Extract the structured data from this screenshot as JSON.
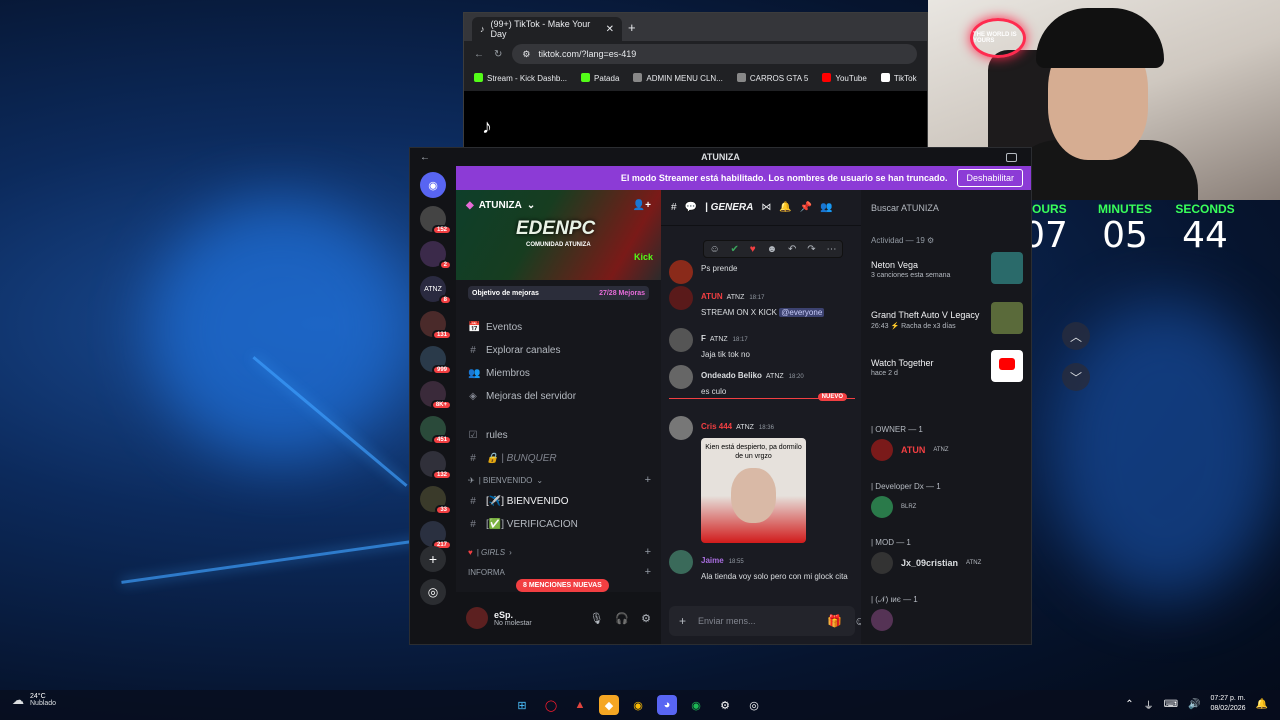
{
  "browser": {
    "tab_title": "(99+) TikTok - Make Your Day",
    "url": "tiktok.com/?lang=es-419",
    "bookmarks": [
      {
        "label": "Stream - Kick Dashb...",
        "color": "#53fc18"
      },
      {
        "label": "Patada",
        "color": "#53fc18"
      },
      {
        "label": "ADMIN MENU CLN...",
        "color": "#888888"
      },
      {
        "label": "CARROS GTA 5",
        "color": "#888888"
      },
      {
        "label": "YouTube",
        "color": "#ff0000"
      },
      {
        "label": "TikTok",
        "color": "#ffffff"
      }
    ]
  },
  "webcam": {
    "sign": "THE WORLD IS YOURS"
  },
  "timer": {
    "hours_label": "HOURS",
    "hours": "07",
    "minutes_label": "MINUTES",
    "minutes": "05",
    "seconds_label": "SECONDS",
    "seconds": "44"
  },
  "discord": {
    "window_title": "ATUNIZA",
    "streamer_banner": "El modo Streamer está habilitado. Los nombres de usuario se han truncado.",
    "disable_button": "Deshabilitar",
    "servers": [
      {
        "badge": "152",
        "label": ""
      },
      {
        "badge": "2",
        "label": ""
      },
      {
        "badge": "8",
        "label": "ATNZ"
      },
      {
        "badge": "131",
        "label": ""
      },
      {
        "badge": "999",
        "label": ""
      },
      {
        "badge": "8K+",
        "label": ""
      },
      {
        "badge": "451",
        "label": ""
      },
      {
        "badge": "132",
        "label": ""
      },
      {
        "badge": "33",
        "label": ""
      },
      {
        "badge": "217",
        "label": ""
      }
    ],
    "server": {
      "name": "ATUNIZA",
      "banner_logo": "EDENPC",
      "banner_sub": "COMUNIDAD ATUNIZA",
      "banner_kick": "Kick",
      "boost_label": "Objetivo de mejoras",
      "boost_count": "27/28 Mejoras"
    },
    "channels": [
      {
        "icon": "📅",
        "label": "Eventos"
      },
      {
        "icon": "#",
        "label": "Explorar canales"
      },
      {
        "icon": "👥",
        "label": "Miembros"
      },
      {
        "icon": "◈",
        "label": "Mejoras del servidor"
      },
      {
        "icon": "☑",
        "label": "rules"
      },
      {
        "icon": "#",
        "label": "🔒 | BUNQUER"
      }
    ],
    "category_welcome": "| BIENVENIDO",
    "welcome_channels": [
      "[✈️] BIENVENIDO",
      "[✅] VERIFICACION"
    ],
    "category_girls": "| GIRLS",
    "category_info": "INFORMA",
    "mentions_pill": "8 MENCIONES NUEVAS",
    "user": {
      "name": "eSp.",
      "status": "No molestar"
    },
    "chat": {
      "channel": "| GENERA",
      "messages": [
        {
          "name": "",
          "tag": "",
          "time": "",
          "text": "Ps prende",
          "color": "#dbdee1"
        },
        {
          "name": "ATUN",
          "tag": "ATNZ",
          "time": "18:17",
          "text": "STREAM ON X KICK",
          "mention": "@everyone",
          "color": "#f23f42"
        },
        {
          "name": "F",
          "tag": "ATNZ",
          "time": "18:17",
          "text": "Jaja tik tok no",
          "color": "#dbdee1"
        },
        {
          "name": "Ondeado Beliko",
          "tag": "ATNZ",
          "time": "18:20",
          "text": "es culo",
          "color": "#dbdee1"
        },
        {
          "name": "Cris 444",
          "tag": "ATNZ",
          "time": "18:36",
          "text": "",
          "color": "#f23f42"
        },
        {
          "name": "Jaime",
          "tag": "",
          "time": "18:55",
          "text": "Ala tienda voy solo pero con mi glock cita",
          "color": "#a86dde"
        }
      ],
      "image_caption": "Kien está despierto, pa dormilo de un vrgzo",
      "new_badge": "NUEVO",
      "composer_placeholder": "Enviar mens..."
    },
    "members": {
      "search": "Buscar ATUNIZA",
      "activity_header": "Actividad — 19",
      "activities": [
        {
          "title": "Neton Vega",
          "sub": "3 canciones esta semana"
        },
        {
          "title": "Grand Theft Auto V Legacy",
          "sub": "26:43 ⚡ Racha de x3 días"
        },
        {
          "title": "Watch Together",
          "sub": "hace 2 d"
        }
      ],
      "roles": [
        {
          "label": "| OWNER — 1",
          "member": "ATUN",
          "tag": "ATNZ",
          "color": "#f23f42"
        },
        {
          "label": "| Developer Dx — 1",
          "member": "",
          "tag": "BLRZ",
          "color": "#dbdee1"
        },
        {
          "label": "| MOD — 1",
          "member": "Jx_09cristian",
          "tag": "ATNZ",
          "color": "#dbdee1"
        },
        {
          "label": "| (𝒩) ιиє — 1",
          "member": "",
          "tag": "",
          "color": "#a86dde"
        }
      ]
    }
  },
  "taskbar": {
    "temp": "24°C",
    "weather": "Nublado",
    "time": "07:27 p. m.",
    "date": "08/02/2026"
  }
}
